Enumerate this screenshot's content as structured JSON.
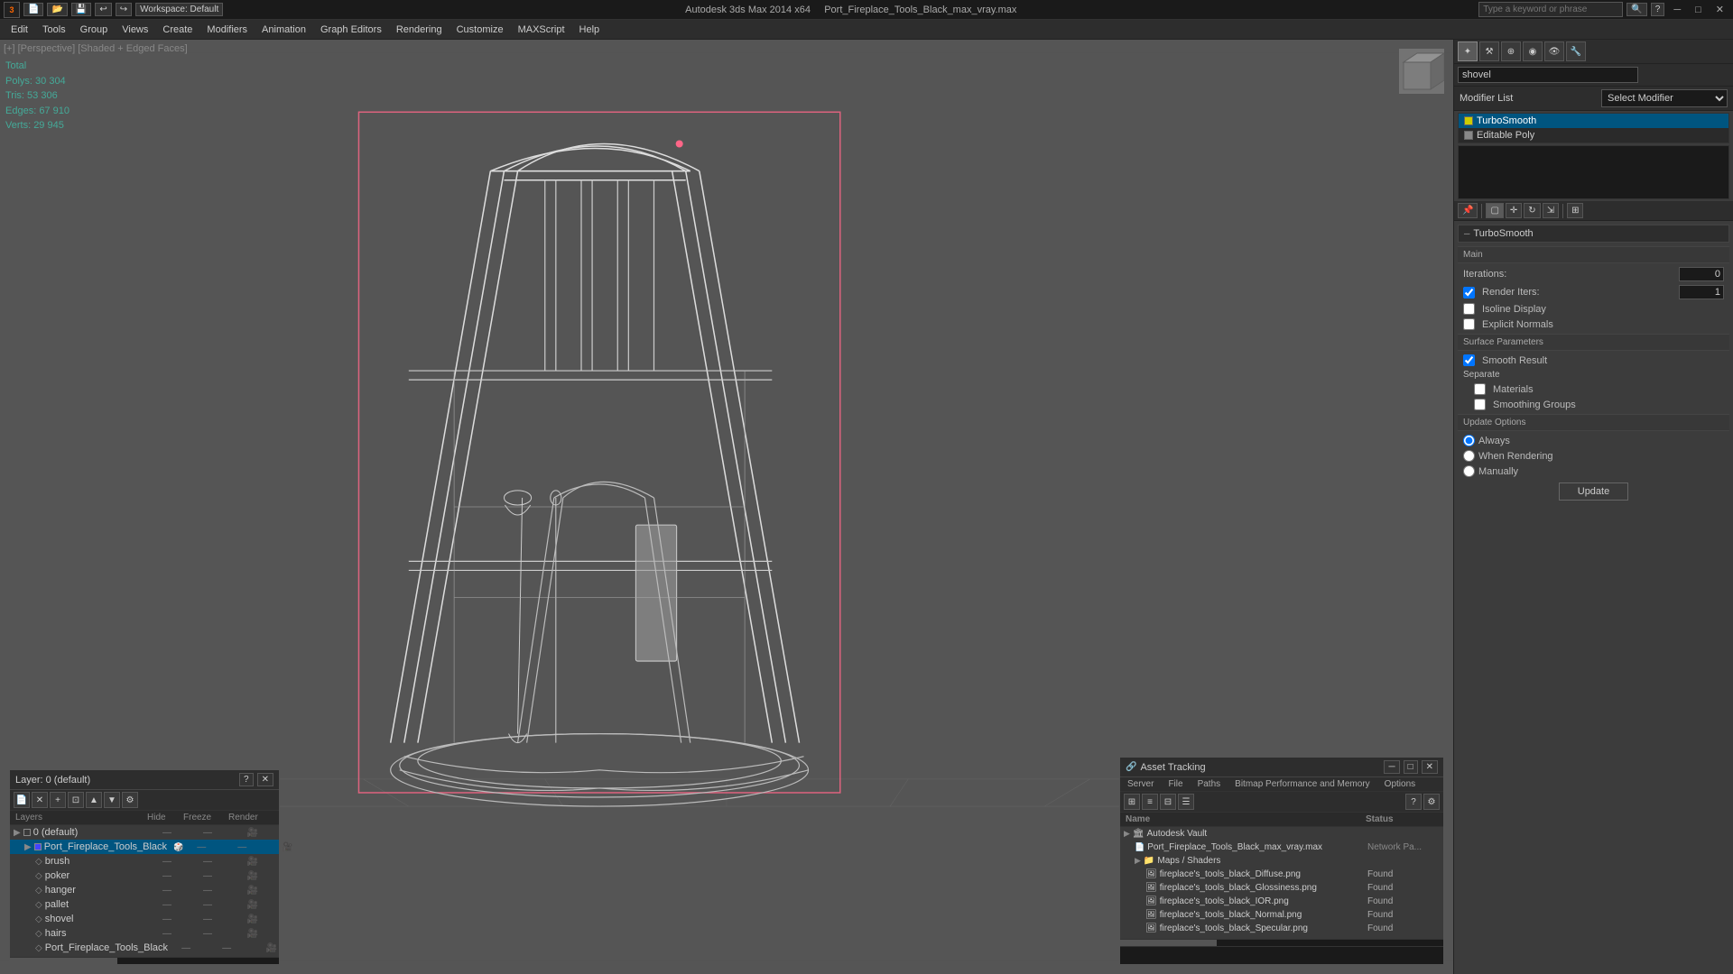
{
  "titlebar": {
    "app_name": "3ds Max",
    "logo": "3",
    "file_title": "Autodesk 3ds Max 2014 x64",
    "file_name": "Port_Fireplace_Tools_Black_max_vray.max",
    "search_placeholder": "Type a keyword or phrase",
    "workspace_label": "Workspace: Default"
  },
  "menubar": {
    "items": [
      "Edit",
      "Tools",
      "Group",
      "Views",
      "Create",
      "Modifiers",
      "Animation",
      "Graph Editors",
      "Rendering",
      "Customize",
      "MAXScript",
      "Help"
    ]
  },
  "breadcrumb": {
    "text": "[+] [Perspective] [Shaded + Edged Faces]"
  },
  "stats": {
    "total_label": "Total",
    "polys_label": "Polys:",
    "polys_value": "30 304",
    "tris_label": "Tris:",
    "tris_value": "53 306",
    "edges_label": "Edges:",
    "edges_value": "67 910",
    "verts_label": "Verts:",
    "verts_value": "29 945"
  },
  "right_panel": {
    "obj_name": "shovel",
    "modifier_list_label": "Modifier List",
    "modifiers": [
      {
        "name": "TurboSmooth",
        "active": true
      },
      {
        "name": "Editable Poly",
        "active": false
      }
    ],
    "turbosmooth": {
      "section_label": "TurboSmooth",
      "main_label": "Main",
      "iterations_label": "Iterations:",
      "iterations_value": "0",
      "render_iters_label": "Render Iters:",
      "render_iters_value": "1",
      "isoline_label": "Isoline Display",
      "explicit_normals_label": "Explicit Normals",
      "surface_params_label": "Surface Parameters",
      "smooth_result_label": "Smooth Result",
      "smooth_result_checked": true,
      "separate_label": "Separate",
      "materials_label": "Materials",
      "smoothing_groups_label": "Smoothing Groups",
      "update_options_label": "Update Options",
      "always_label": "Always",
      "when_rendering_label": "When Rendering",
      "manually_label": "Manually",
      "update_btn": "Update"
    }
  },
  "layers_panel": {
    "title": "Layer: 0 (default)",
    "columns": {
      "layers": "Layers",
      "hide": "Hide",
      "freeze": "Freeze",
      "render": "Render"
    },
    "items": [
      {
        "name": "0 (default)",
        "type": "layer",
        "indent": 0,
        "active": false
      },
      {
        "name": "Port_Fireplace_Tools_Black",
        "type": "layer",
        "indent": 1,
        "active": true
      },
      {
        "name": "brush",
        "type": "object",
        "indent": 2,
        "active": false
      },
      {
        "name": "poker",
        "type": "object",
        "indent": 2,
        "active": false
      },
      {
        "name": "hanger",
        "type": "object",
        "indent": 2,
        "active": false
      },
      {
        "name": "pallet",
        "type": "object",
        "indent": 2,
        "active": false
      },
      {
        "name": "shovel",
        "type": "object",
        "indent": 2,
        "active": false
      },
      {
        "name": "hairs",
        "type": "object",
        "indent": 2,
        "active": false
      },
      {
        "name": "Port_Fireplace_Tools_Black",
        "type": "object",
        "indent": 2,
        "active": false
      }
    ]
  },
  "asset_panel": {
    "title": "Asset Tracking",
    "menu_items": [
      "Server",
      "File",
      "Paths",
      "Bitmap Performance and Memory",
      "Options"
    ],
    "col_name": "Name",
    "col_status": "Status",
    "items": [
      {
        "name": "Autodesk Vault",
        "indent": 0,
        "status": "",
        "type": "group",
        "icon": "vault"
      },
      {
        "name": "Port_Fireplace_Tools_Black_max_vray.max",
        "indent": 1,
        "status": "Network Pa...",
        "type": "file",
        "icon": "file"
      },
      {
        "name": "Maps / Shaders",
        "indent": 1,
        "status": "",
        "type": "group",
        "icon": "folder"
      },
      {
        "name": "fireplace's_tools_black_Diffuse.png",
        "indent": 2,
        "status": "Found",
        "type": "image",
        "icon": "img"
      },
      {
        "name": "fireplace's_tools_black_Glossiness.png",
        "indent": 2,
        "status": "Found",
        "type": "image",
        "icon": "img"
      },
      {
        "name": "fireplace's_tools_black_IOR.png",
        "indent": 2,
        "status": "Found",
        "type": "image",
        "icon": "img"
      },
      {
        "name": "fireplace's_tools_black_Normal.png",
        "indent": 2,
        "status": "Found",
        "type": "image",
        "icon": "img"
      },
      {
        "name": "fireplace's_tools_black_Specular.png",
        "indent": 2,
        "status": "Found",
        "type": "image",
        "icon": "img"
      }
    ]
  },
  "icons": {
    "search": "🔍",
    "close": "✕",
    "minimize": "─",
    "maximize": "□",
    "arrow_down": "▼",
    "arrow_right": "▶",
    "collapse": "─",
    "layer": "≡",
    "object": "◇",
    "file": "📄",
    "folder": "📁",
    "img": "🖼",
    "vault": "🏛"
  }
}
